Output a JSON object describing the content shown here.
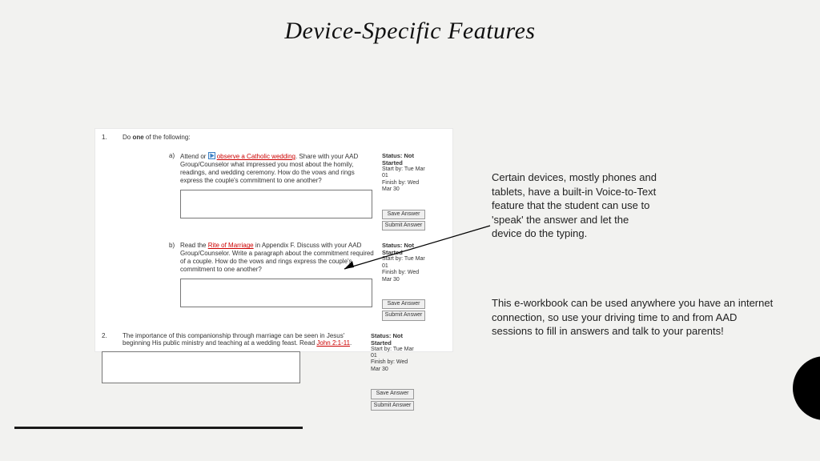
{
  "title": "Device-Specific Features",
  "para1": "Certain devices, mostly phones and tablets, have a built-in Voice-to-Text feature that the student can use to 'speak' the answer and let the device do the typing.",
  "para2": "This e-workbook can be used anywhere you have an internet connection, so use your driving time to and from AAD sessions to fill in answers and talk to your parents!",
  "q1": {
    "num": "1.",
    "prompt_pre": "Do ",
    "prompt_bold": "one",
    "prompt_post": " of the following:",
    "a": {
      "label": "a)",
      "pre": "Attend or ",
      "link": "observe a Catholic wedding",
      "post": ". Share with your AAD Group/Counselor what impressed you most about the homily, readings, and wedding ceremony. How do the vows and rings express the couple's commitment to one another?"
    },
    "b": {
      "label": "b)",
      "pre": "Read the ",
      "link": "Rite of Marriage",
      "post": " in Appendix F. Discuss with your AAD Group/Counselor. Write a paragraph about the commitment required of a couple. How do the vows and rings express the couple's commitment to one another?"
    }
  },
  "q2": {
    "num": "2.",
    "pre": "The importance of this companionship through marriage can be seen in Jesus' beginning His public ministry and teaching at a wedding feast. Read ",
    "link": "John 2:1-11",
    "post": "."
  },
  "status": {
    "title": "Status: Not Started",
    "start": "Start by: Tue Mar 01",
    "finish": "Finish by: Wed Mar 30"
  },
  "btn": {
    "save": "Save Answer",
    "submit": "Submit Answer"
  }
}
